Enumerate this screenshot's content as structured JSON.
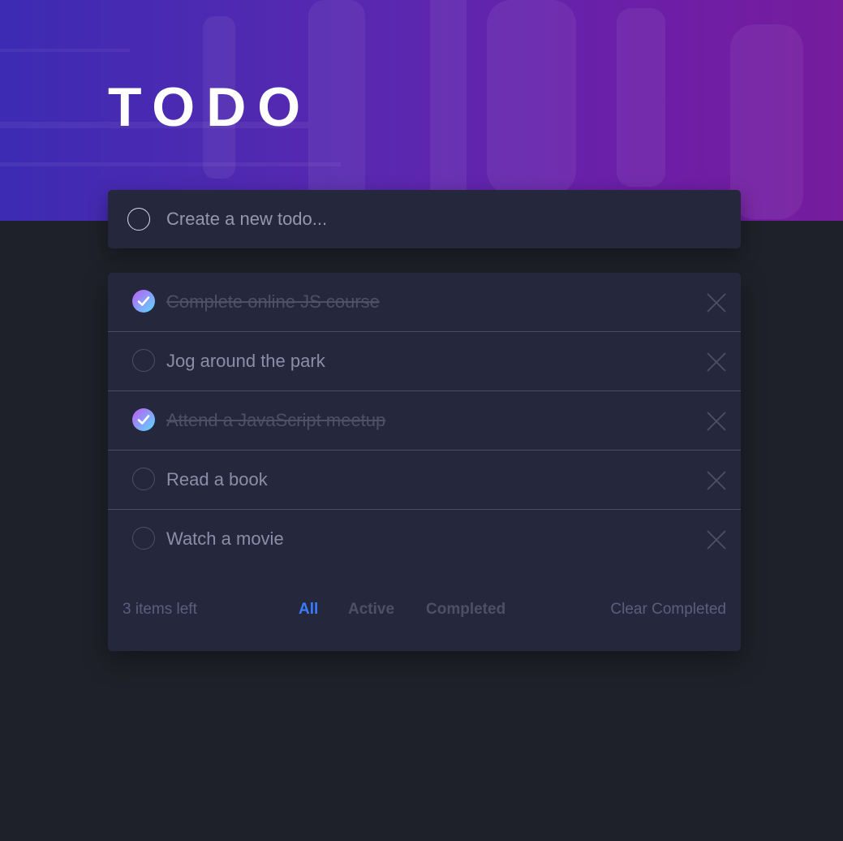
{
  "header": {
    "title": "TODO"
  },
  "new_todo": {
    "placeholder": "Create a new todo..."
  },
  "todos": [
    {
      "text": "Complete online JS course",
      "completed": true
    },
    {
      "text": "Jog around the park",
      "completed": false
    },
    {
      "text": "Attend a JavaScript meetup",
      "completed": true
    },
    {
      "text": "Read a book",
      "completed": false
    },
    {
      "text": "Watch a movie",
      "completed": false
    }
  ],
  "footer": {
    "items_left": "3 items left",
    "filters": [
      "All",
      "Active",
      "Completed"
    ],
    "active_filter": "All",
    "clear_label": "Clear Completed"
  },
  "colors": {
    "background": "#1f212a",
    "card": "#25273c",
    "accent": "#3a7cfd",
    "check_gradient_start": "#c058f3",
    "check_gradient_end": "#57ddff",
    "banner_start": "#3d2bb3",
    "banner_end": "#761c9d"
  },
  "icons": {
    "check": "check-icon",
    "delete": "cross-icon"
  }
}
